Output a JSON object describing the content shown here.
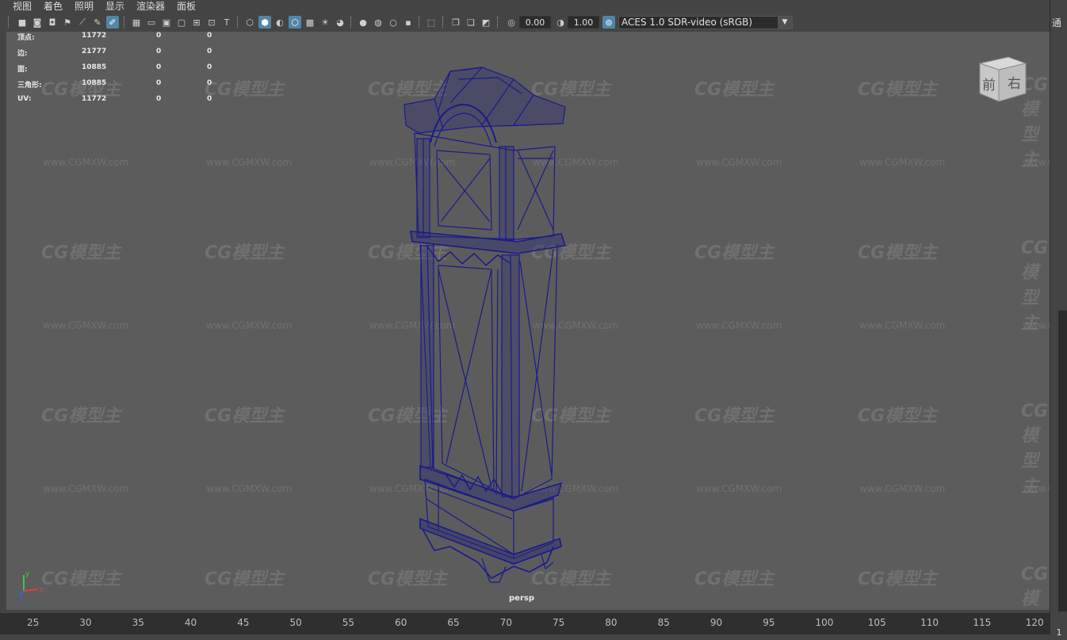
{
  "menubar": {
    "items": [
      "视图",
      "着色",
      "照明",
      "显示",
      "渲染器",
      "面板"
    ]
  },
  "toolbar": {
    "exposure_value": "0.00",
    "gamma_value": "1.00",
    "color_space": "ACES 1.0 SDR-video (sRGB)"
  },
  "hud": {
    "rows": [
      {
        "label": "顶点:",
        "v1": "11772",
        "v2": "0",
        "v3": "0"
      },
      {
        "label": "边:",
        "v1": "21777",
        "v2": "0",
        "v3": "0"
      },
      {
        "label": "面:",
        "v1": "10885",
        "v2": "0",
        "v3": "0"
      },
      {
        "label": "三角形:",
        "v1": "10885",
        "v2": "0",
        "v3": "0"
      },
      {
        "label": "UV:",
        "v1": "11772",
        "v2": "0",
        "v3": "0"
      }
    ]
  },
  "viewcube": {
    "front": "前",
    "right": "右"
  },
  "viewport": {
    "camera": "persp",
    "watermark_logo": "CG模型主",
    "watermark_url": "www.CGMXW.com",
    "wireframe_color": "#1a1a8c",
    "background_color": "#5c5c5c"
  },
  "axis": {
    "y": "y",
    "x": "x",
    "z": "z"
  },
  "timeline": {
    "ticks": [
      "25",
      "30",
      "35",
      "40",
      "45",
      "50",
      "55",
      "60",
      "65",
      "70",
      "75",
      "80",
      "85",
      "90",
      "95",
      "100",
      "105",
      "110",
      "115",
      "120"
    ],
    "current_frame": "1"
  },
  "right_panel": {
    "top_char": "通"
  }
}
